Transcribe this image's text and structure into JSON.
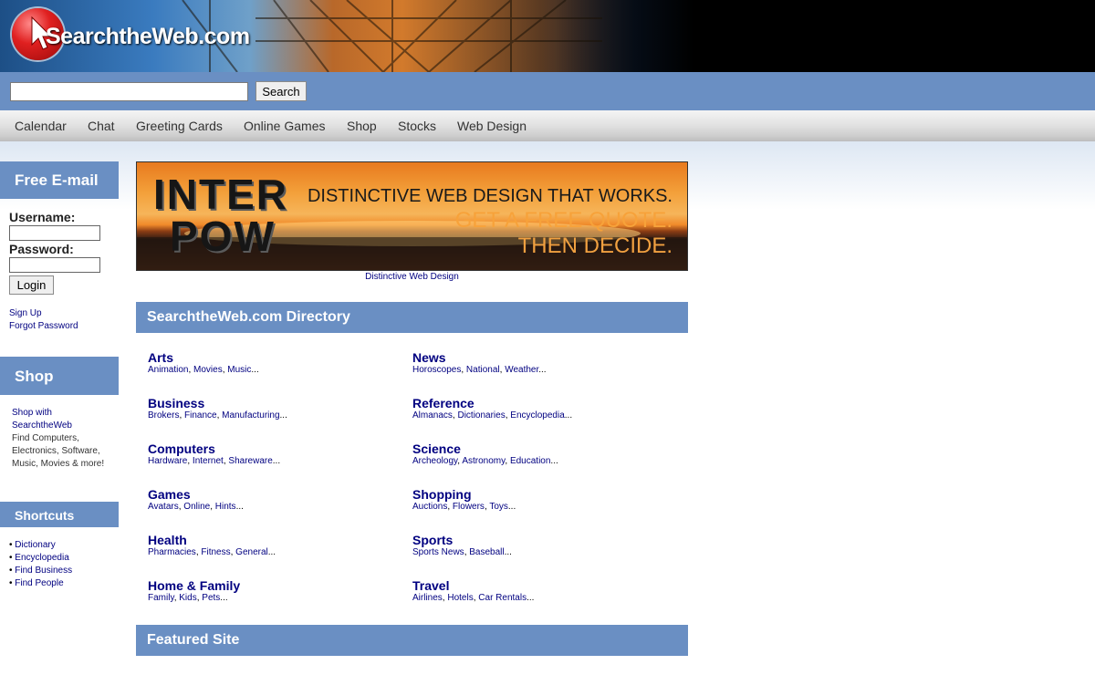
{
  "header": {
    "logo_brand": "SearchtheWeb.com"
  },
  "search": {
    "value": "",
    "placeholder": "",
    "button_label": "Search"
  },
  "nav": {
    "items": [
      "Calendar",
      "Chat",
      "Greeting Cards",
      "Online Games",
      "Shop",
      "Stocks",
      "Web Design"
    ]
  },
  "sidebar": {
    "email_title": "Free E-mail",
    "username_label": "Username:",
    "password_label": "Password:",
    "login_label": "Login",
    "signup_link": "Sign Up",
    "forgot_link": "Forgot Password",
    "shop_title": "Shop",
    "shop_link": "Shop with SearchtheWeb",
    "shop_text": "Find Computers, Electronics, Software, Music, Movies & more!",
    "shortcuts_title": "Shortcuts",
    "shortcuts": [
      "Dictionary",
      "Encyclopedia",
      "Find Business",
      "Find People"
    ]
  },
  "banner": {
    "brand_line1": "INTER",
    "brand_line2": "POW",
    "tagline1": "DISTINCTIVE WEB DESIGN THAT WORKS.",
    "tagline2": "GET A FREE QUOTE.",
    "tagline3": "THEN DECIDE.",
    "caption": "Distinctive Web Design"
  },
  "directory": {
    "title": "SearchtheWeb.com Directory",
    "categories": [
      {
        "name": "Arts",
        "subs": [
          "Animation",
          "Movies",
          "Music"
        ]
      },
      {
        "name": "News",
        "subs": [
          "Horoscopes",
          "National",
          "Weather"
        ]
      },
      {
        "name": "Business",
        "subs": [
          "Brokers",
          "Finance",
          "Manufacturing"
        ]
      },
      {
        "name": "Reference",
        "subs": [
          "Almanacs",
          "Dictionaries",
          "Encyclopedia"
        ]
      },
      {
        "name": "Computers",
        "subs": [
          "Hardware",
          "Internet",
          "Shareware"
        ]
      },
      {
        "name": "Science",
        "subs": [
          "Archeology",
          "Astronomy",
          "Education"
        ]
      },
      {
        "name": "Games",
        "subs": [
          "Avatars",
          "Online",
          "Hints"
        ]
      },
      {
        "name": "Shopping",
        "subs": [
          "Auctions",
          "Flowers",
          "Toys"
        ]
      },
      {
        "name": "Health",
        "subs": [
          "Pharmacies",
          "Fitness",
          "General"
        ]
      },
      {
        "name": "Sports",
        "subs": [
          "Sports News",
          "Baseball"
        ]
      },
      {
        "name": "Home & Family",
        "subs": [
          "Family",
          "Kids",
          "Pets"
        ]
      },
      {
        "name": "Travel",
        "subs": [
          "Airlines",
          "Hotels",
          "Car Rentals"
        ]
      }
    ]
  },
  "featured": {
    "title": "Featured Site"
  },
  "colors": {
    "accent_blue": "#6a8fc3",
    "link_navy": "#000080",
    "banner_orange": "#e87a1e"
  }
}
